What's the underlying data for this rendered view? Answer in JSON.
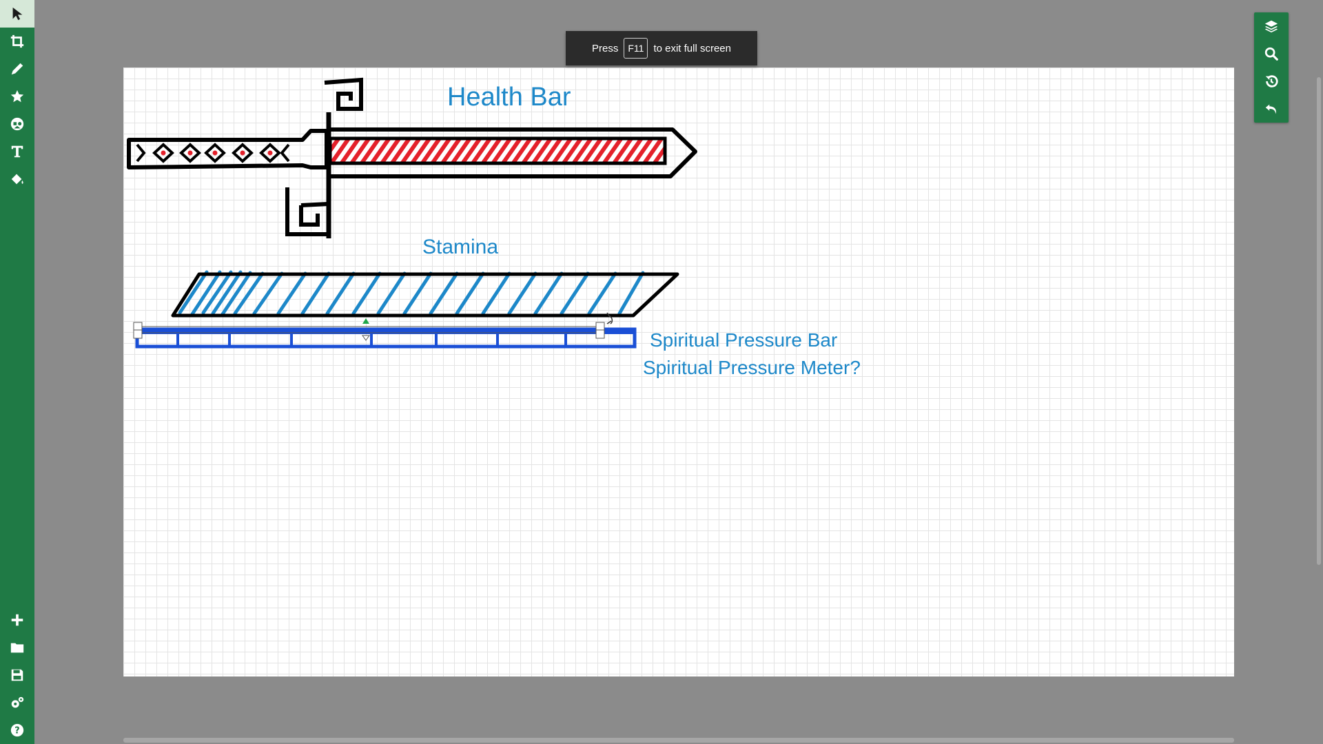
{
  "toolbar": {
    "tools": [
      {
        "name": "select-tool",
        "icon": "cursor-arrow-icon",
        "active": true
      },
      {
        "name": "crop-tool",
        "icon": "crop-icon"
      },
      {
        "name": "pen-tool",
        "icon": "pencil-icon"
      },
      {
        "name": "favorites-tool",
        "icon": "star-icon"
      },
      {
        "name": "shapes-tool",
        "icon": "shapes-icon"
      },
      {
        "name": "text-tool",
        "icon": "text-t-icon"
      },
      {
        "name": "fill-tool",
        "icon": "paint-bucket-icon"
      }
    ],
    "bottom_tools": [
      {
        "name": "new-button",
        "icon": "plus-icon"
      },
      {
        "name": "open-button",
        "icon": "folder-icon"
      },
      {
        "name": "save-button",
        "icon": "floppy-disk-icon"
      },
      {
        "name": "settings-button",
        "icon": "gears-icon"
      },
      {
        "name": "help-button",
        "icon": "question-circle-icon"
      }
    ]
  },
  "right_panel": [
    {
      "name": "layers-button",
      "icon": "layers-icon"
    },
    {
      "name": "zoom-button",
      "icon": "magnifier-icon"
    },
    {
      "name": "history-button",
      "icon": "history-icon"
    },
    {
      "name": "undo-button",
      "icon": "undo-icon"
    }
  ],
  "fullscreen_notice": {
    "before": "Press",
    "key": "F11",
    "after": "to exit full screen"
  },
  "canvas": {
    "labels": {
      "health": "Health Bar",
      "stamina": "Stamina",
      "spiritual_bar": "Spiritual Pressure Bar",
      "spiritual_meter": "Spiritual Pressure Meter?"
    },
    "colors": {
      "health_fill": "#e4212b",
      "stamina_fill": "#1d88c9",
      "spiritual_bar": "#1a4fd6",
      "label_text": "#1d88c9",
      "outline": "#000000"
    }
  },
  "ui_colors": {
    "toolbar_bg": "#1f7a45",
    "workspace_bg": "#8b8b8b"
  }
}
